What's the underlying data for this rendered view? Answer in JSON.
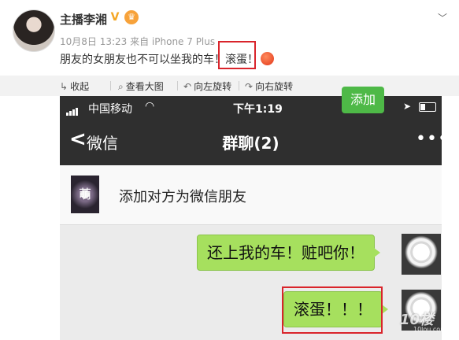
{
  "post": {
    "author": "主播李湘",
    "meta": "10月8日 13:23 来自 iPhone 7 Plus",
    "text": "朋友的女朋友也不可以坐我的车！滚蛋！"
  },
  "toolbar": {
    "collapse": "收起",
    "view_large": "查看大图",
    "rotate_left": "向左旋转",
    "rotate_right": "向右旋转"
  },
  "phone": {
    "status": {
      "carrier": "中国移动",
      "time": "下午1:19"
    },
    "nav": {
      "back_label": "微信",
      "title": "群聊(2)"
    },
    "friend_banner": {
      "avatar_text": "萌",
      "text": "添加对方为微信朋友",
      "button": "添加"
    },
    "messages": [
      {
        "text": "还上我的车！赃吧你！"
      },
      {
        "text": "滚蛋！！！"
      }
    ]
  },
  "watermark": {
    "main": "10楼",
    "sub": "10lou.com"
  },
  "colors": {
    "highlight": "#d9242b",
    "bubble": "#a6e05e",
    "add_button": "#4eb947"
  }
}
